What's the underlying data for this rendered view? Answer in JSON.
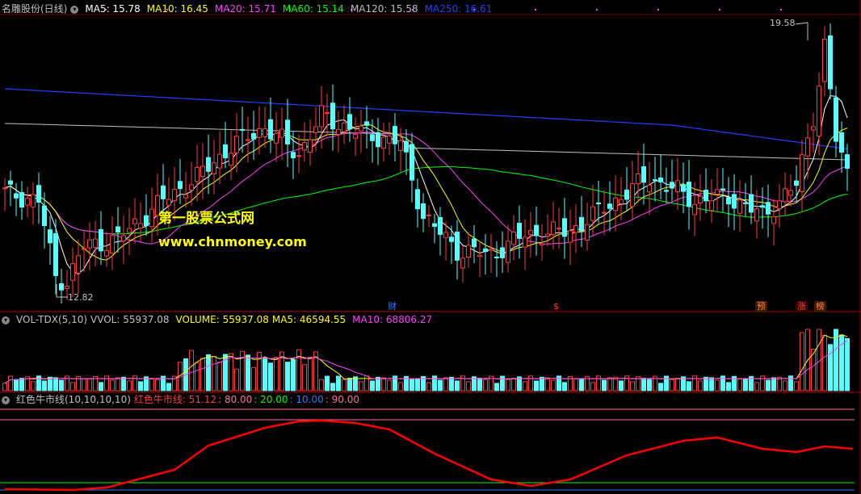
{
  "main_header": {
    "title": "名雕股份(日线)",
    "ma5": "MA5: 15.78",
    "ma10": "MA10: 16.45",
    "ma20": "MA20: 15.71",
    "ma60": "MA60: 15.14",
    "ma120": "MA120: 15.58",
    "ma250": "MA250: 16.61"
  },
  "price_labels": {
    "high": "19.58",
    "low": "12.82"
  },
  "watermark": {
    "line1": "第一股票公式网",
    "line2": "www.chnmoney.com"
  },
  "event_markers": [
    {
      "text": "财",
      "color": "#2b7bff"
    },
    {
      "text": "$",
      "color": "#ff3b3b"
    },
    {
      "text": "预",
      "color": "#ff8040"
    },
    {
      "text": "涨",
      "color": "#ff3b3b"
    },
    {
      "text": "榜",
      "color": "#ff8040"
    }
  ],
  "vol_header": {
    "name": "VOL-TDX(5,10)",
    "vvol": "VVOL: 55937.08",
    "volume": "VOLUME: 55937.08",
    "ma5": "MA5: 46594.55",
    "ma10": "MA10: 68806.27"
  },
  "ind_header": {
    "name": "红色牛市线(10,10,10,10)",
    "line": "红色牛市线: 51.12",
    "l80": ": 80.00",
    "l20": ": 20.00",
    "l10": ": 10.00",
    "l90": ": 90.00"
  },
  "colors": {
    "up": "#ff3b3b",
    "down": "#54ffff",
    "ma5": "#ffffff",
    "ma10": "#ffff00",
    "ma20": "#ff40ff",
    "ma60": "#00ff00",
    "ma120": "#c0c0c0",
    "ma250": "#2040ff",
    "bull_line": "#ff0000"
  },
  "chart_data": {
    "type": "candlestick",
    "price_high": 19.58,
    "price_low": 12.82,
    "indicator_levels": [
      80,
      20,
      10,
      90
    ],
    "indicator_last": 51.12
  }
}
